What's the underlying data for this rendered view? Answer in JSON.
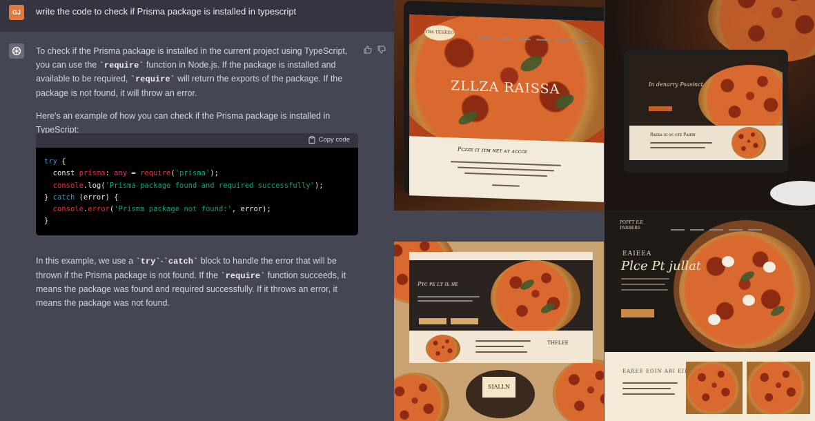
{
  "user": {
    "initials": "GJ",
    "message": "write the code to check if Prisma package is installed in typescript"
  },
  "assistant": {
    "p1": {
      "a": "To check if the Prisma package is installed in the current project using TypeScript, you can use the ",
      "code1": "`require`",
      "b": " function in Node.js. If the package is installed and available to be required, ",
      "code2": "`require`",
      "c": " will return the exports of the package. If the package is not found, it will throw an error."
    },
    "p2": "Here's an example of how you can check if the Prisma package is installed in TypeScript:",
    "code_block": {
      "copy_label": "Copy code",
      "lines": [
        "try {",
        "  const prisma: any = require('prisma');",
        "  console.log('Prisma package found and required successfully');",
        "} catch (error) {",
        "  console.error('Prisma package not found:', error);",
        "}"
      ]
    },
    "p3": {
      "a": "In this example, we use a ",
      "code1": "`try`",
      "dash": "-",
      "code2": "`catch`",
      "b": " block to handle the error that will be thrown if the Prisma package is not found. If the ",
      "code3": "`require`",
      "c": " function succeeds, it means the package was found and required successfully. If it throws an error, it means the package was not found."
    }
  },
  "images": {
    "tile1_title": "ZLLZA RAISSA",
    "tile1_logo": "YRA TEHEEO",
    "tile1_tagline": "Pᴄᴢᴢᴇ ɪᴛ ɪᴛᴍ ɴᴇᴛ ᴀᴛ ᴀᴄᴄᴄᴇ",
    "tile2_heading": "In denarry Psasinct",
    "tile2_sub": "Rᴀᴇᴇᴀ ɢɪ ᴏᴄ ᴏᴛᴇ Pᴀɪᴇᴍ",
    "tile3_heading": "Pᴛᴄ ᴘᴇ ʟᴛ ɪʟ ɴᴇ",
    "tile3_stamp": "SIALLN",
    "tile3_side": "THELEE",
    "tile4_logo": "POFFT ILE PARBERS",
    "tile4_kicker": "EAIEEA",
    "tile4_heading": "Plce Pt jullat",
    "tile4_sub": "EAREE EOIN ARI EIL",
    "colors": {
      "chat_bg": "#444654",
      "user_bg": "#343541",
      "code_bg": "#000000",
      "accent": "#e07a3e"
    }
  }
}
